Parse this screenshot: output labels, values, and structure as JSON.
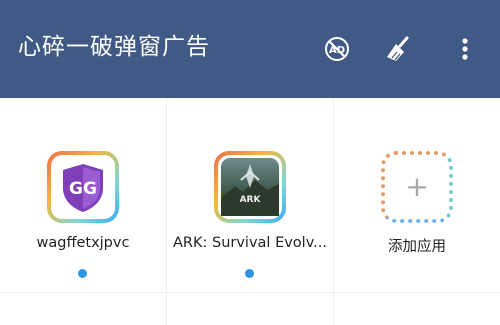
{
  "header": {
    "title": "心碎一破弹窗广告",
    "background": "#405a85",
    "icons": [
      "ad-block-icon",
      "broom-clean-icon",
      "more-vertical-icon"
    ],
    "ad_icon_text": "AD"
  },
  "apps": [
    {
      "label": "wagffetxjpvc",
      "icon": "game-guardian-icon",
      "badge_text": "GG",
      "has_dot": true
    },
    {
      "label": "ARK: Survival Evolv...",
      "icon": "ark-survival-icon",
      "badge_text": "ARK",
      "has_dot": true
    },
    {
      "label": "添加应用",
      "icon": "add-app-icon",
      "badge_text": "+",
      "has_dot": false
    }
  ],
  "colors": {
    "dot": "#2e94e6",
    "divider": "#eceef1"
  }
}
